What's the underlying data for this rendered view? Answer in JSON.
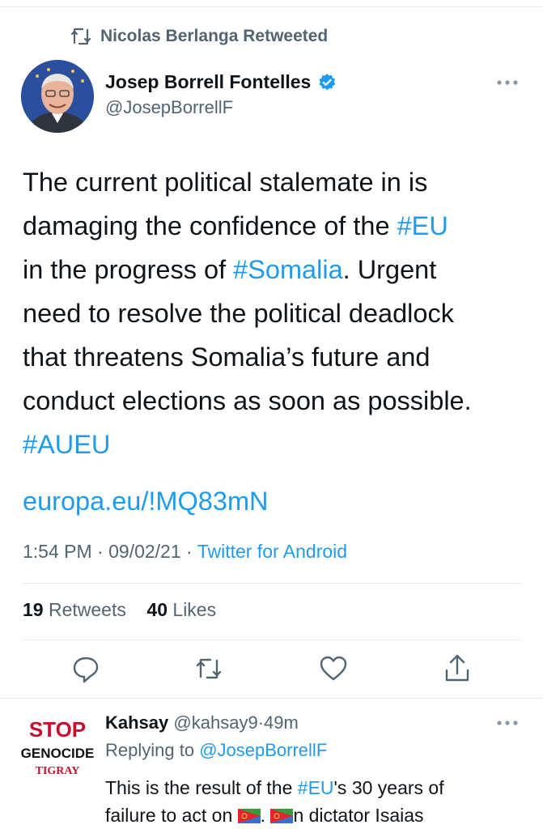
{
  "retweet_header": {
    "label": "Nicolas Berlanga Retweeted"
  },
  "tweet": {
    "author_name": "Josep Borrell Fontelles",
    "author_handle": "@JosepBorrellF",
    "text_lines": [
      {
        "a": "The current political stalemate in is"
      },
      {
        "a": "damaging the confidence of the ",
        "link": "#EU"
      },
      {
        "a": "in the progress of ",
        "link": "#Somalia",
        "b": ". Urgent"
      },
      {
        "a": "need to resolve the political deadlock"
      },
      {
        "a": "that threatens Somalia’s future and"
      },
      {
        "a": "conduct elections as soon as possible."
      }
    ],
    "hashtag": "#AUEU",
    "url": "europa.eu/!MQ83mN",
    "time": "1:54 PM",
    "date": "09/02/21",
    "dot": "·",
    "source": "Twitter for Android",
    "retweet_count": "19",
    "retweets_label": "Retweets",
    "like_count": "40",
    "likes_label": "Likes"
  },
  "reply": {
    "name": "Kahsay",
    "handle": "@kahsay9",
    "age": "49m",
    "replying_prefix": "Replying to",
    "replying_to": "@JosepBorrellF",
    "line1_a": "This is the result of the ",
    "line1_link": "#EU",
    "line1_b": "'s 30 years of",
    "line2_a": "failure to act on ",
    "line2_b": ". ",
    "line2_c": "n dictator Isaias",
    "avatar_text": [
      "STOP",
      "GENOCIDE",
      "TIGRAY"
    ]
  },
  "icons": {
    "retweet_header": "retweet-icon",
    "verified": "verified-badge-icon",
    "more": "more-options-icon",
    "reply": "reply-icon",
    "retweet": "retweet-icon",
    "like": "heart-icon",
    "share": "share-icon",
    "flag": "eritrea-flag-icon"
  },
  "colors": {
    "link": "#1d9bf0",
    "secondary_text": "#536471",
    "primary_text": "#0f1419",
    "divider": "#e6ecf0"
  }
}
